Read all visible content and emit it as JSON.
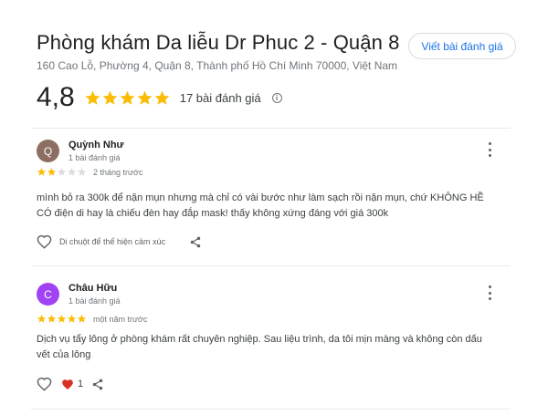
{
  "place": {
    "title": "Phòng khám Da liễu Dr Phuc 2 - Quận 8",
    "address": "160 Cao Lỗ, Phường 4, Quận 8, Thành phố Hồ Chí Minh 70000, Việt Nam",
    "write_review_label": "Viết bài đánh giá"
  },
  "summary": {
    "rating": "4,8",
    "stars": 5,
    "review_count_label": "17 bài đánh giá"
  },
  "colors": {
    "star": "#fbbc04",
    "star_empty": "#dadce0",
    "accent": "#1a73e8",
    "heart_liked": "#d93025"
  },
  "reviews": [
    {
      "avatar_letter": "Q",
      "avatar_color": "#8d6e63",
      "author": "Quỳnh Như",
      "author_sub": "1 bài đánh giá",
      "rating": 2,
      "time": "2 tháng trước",
      "text": "mình bỏ ra 300k để nặn mụn nhưng mà chỉ có vài bước như làm sạch rồi nặn mụn, chứ KHÔNG HỀ CÓ điện di hay là chiếu đèn hay đắp mask! thấy không xứng đáng với giá 300k",
      "reaction_hint": "Di chuột để thể hiện cảm xúc"
    },
    {
      "avatar_letter": "C",
      "avatar_color": "#a142f4",
      "author": "Châu Hữu",
      "author_sub": "1 bài đánh giá",
      "rating": 5,
      "time": "một năm trước",
      "text": "Dịch vụ tẩy lông ở phòng khám rất chuyên nghiệp. Sau liệu trình, da tôi mịn màng và không còn dấu vết của lông",
      "like_count": "1"
    }
  ]
}
